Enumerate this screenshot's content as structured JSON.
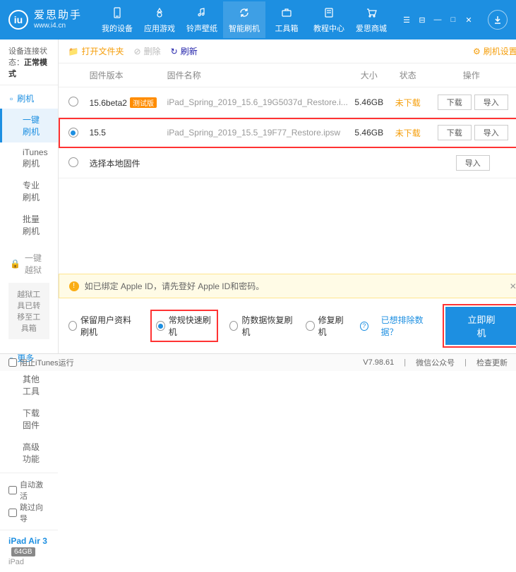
{
  "app": {
    "name": "爱思助手",
    "url": "www.i4.cn"
  },
  "nav": {
    "items": [
      {
        "label": "我的设备"
      },
      {
        "label": "应用游戏"
      },
      {
        "label": "铃声壁纸"
      },
      {
        "label": "智能刷机"
      },
      {
        "label": "工具箱"
      },
      {
        "label": "教程中心"
      },
      {
        "label": "爱思商城"
      }
    ]
  },
  "connection": {
    "label": "设备连接状态：",
    "value": "正常模式"
  },
  "sidebar": {
    "flash": {
      "head": "刷机",
      "items": [
        "一键刷机",
        "iTunes刷机",
        "专业刷机",
        "批量刷机"
      ]
    },
    "jailbreak": {
      "head": "一键越狱",
      "moved": "越狱工具已转移至工具箱"
    },
    "more": {
      "head": "更多",
      "items": [
        "其他工具",
        "下载固件",
        "高级功能"
      ]
    },
    "auto_activate": "自动激活",
    "skip_guide": "跳过向导"
  },
  "device": {
    "name": "iPad Air 3",
    "storage": "64GB",
    "model": "iPad"
  },
  "toolbar": {
    "open_folder": "打开文件夹",
    "delete": "删除",
    "refresh": "刷新",
    "settings": "刷机设置"
  },
  "table": {
    "headers": {
      "version": "固件版本",
      "name": "固件名称",
      "size": "大小",
      "status": "状态",
      "ops": "操作"
    },
    "rows": [
      {
        "version": "15.6beta2",
        "beta": "测试版",
        "name": "iPad_Spring_2019_15.6_19G5037d_Restore.i...",
        "size": "5.46GB",
        "status": "未下载",
        "download": "下载",
        "import": "导入",
        "selected": false
      },
      {
        "version": "15.5",
        "beta": "",
        "name": "iPad_Spring_2019_15.5_19F77_Restore.ipsw",
        "size": "5.46GB",
        "status": "未下载",
        "download": "下载",
        "import": "导入",
        "selected": true
      }
    ],
    "local_row": {
      "label": "选择本地固件",
      "import": "导入"
    }
  },
  "alert": {
    "text": "如已绑定 Apple ID，请先登好 Apple ID和密码。"
  },
  "options": {
    "items": [
      "保留用户资料刷机",
      "常规快速刷机",
      "防数据恢复刷机",
      "修复刷机"
    ],
    "selected": 1,
    "exclude_link": "已想排除数据？",
    "flash_btn": "立即刷机"
  },
  "statusbar": {
    "block_itunes": "阻止iTunes运行",
    "version": "V7.98.61",
    "wechat": "微信公众号",
    "check_update": "检查更新"
  }
}
